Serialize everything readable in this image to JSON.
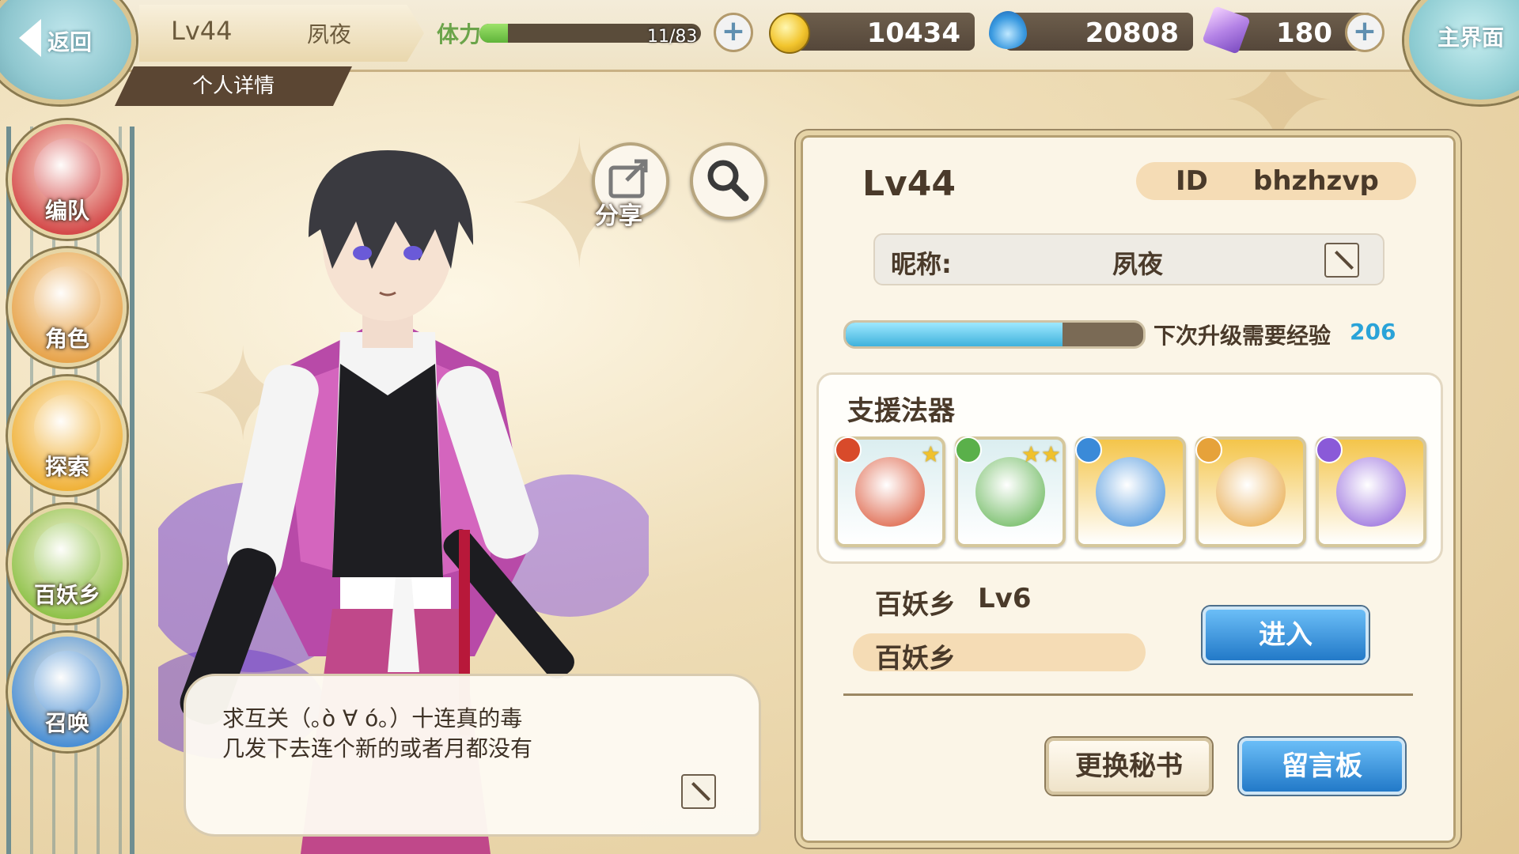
{
  "top_bar": {
    "back_label": "返回",
    "level": "Lv44",
    "player_name": "夙夜",
    "detail_tab": "个人详情",
    "stamina_label": "体力",
    "stamina_value": "11/83",
    "stamina_fraction": 0.13,
    "gold": "10434",
    "soul": "20808",
    "crystal": "180",
    "home_label": "主界面"
  },
  "sidebar": {
    "items": [
      {
        "label": "编队",
        "icon": "party-icon",
        "color": "#d44a4a"
      },
      {
        "label": "角色",
        "icon": "character-icon",
        "color": "#e7a44c"
      },
      {
        "label": "探索",
        "icon": "explore-icon",
        "color": "#f0b23a"
      },
      {
        "label": "百妖乡",
        "icon": "village-icon",
        "color": "#8fc24a"
      },
      {
        "label": "召唤",
        "icon": "summon-icon",
        "color": "#4a8fd4"
      }
    ]
  },
  "actions": {
    "share_label": "分享",
    "share_icon": "share-icon",
    "search_icon": "magnifier-icon"
  },
  "speech": {
    "line1": "求互关（｡ò ∀ ó｡）十连真的毒",
    "line2": "几发下去连个新的或者月都没有",
    "edit_icon": "pencil-icon"
  },
  "profile": {
    "level": "Lv44",
    "id_label": "ID",
    "id_value": "bhzhzvp",
    "nickname_label": "昵称:",
    "nickname_value": "夙夜",
    "exp_fraction": 0.73,
    "exp_label": "下次升级需要经验",
    "exp_value": "206",
    "support_title": "支援法器",
    "support_items": [
      {
        "name": "skull-shield-icon",
        "gem_color": "#d84a2a",
        "stars": "★",
        "bg": "#dbeef0"
      },
      {
        "name": "bead-bracelet-icon",
        "gem_color": "#5ab04a",
        "stars": "★★",
        "bg": "#dbeef0"
      },
      {
        "name": "cloud-sword-icon",
        "gem_color": "#3a8ad8",
        "stars": "",
        "bg": "#f4c54a"
      },
      {
        "name": "crystal-orb-icon",
        "gem_color": "#e6a23a",
        "stars": "",
        "bg": "#f4c54a"
      },
      {
        "name": "beast-blade-icon",
        "gem_color": "#8a5ad8",
        "stars": "",
        "bg": "#f4c54a"
      }
    ],
    "village_title": "百妖乡",
    "village_level": "Lv6",
    "village_name": "百妖乡",
    "enter_label": "进入",
    "change_secretary_label": "更换秘书",
    "message_board_label": "留言板"
  }
}
